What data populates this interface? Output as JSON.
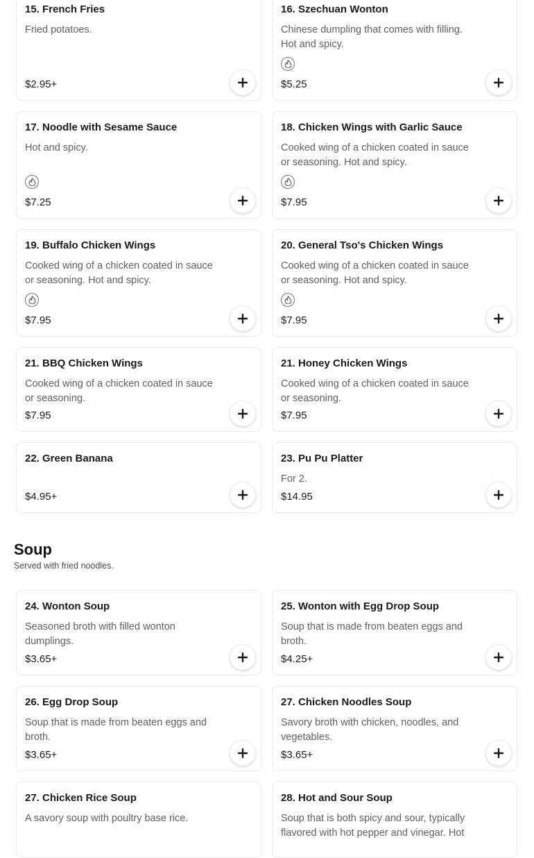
{
  "colors": {
    "accent": "#191919",
    "border": "#ebebeb",
    "muted_text": "#606060",
    "spicy_icon": "#767676"
  },
  "icons": {
    "spicy": "flame-icon",
    "add": "plus-icon"
  },
  "menu_top": {
    "items": [
      {
        "title": "15. French Fries",
        "description": "Fried potatoes.",
        "price": "$2.95+",
        "spicy": false
      },
      {
        "title": "16. Szechuan Wonton",
        "description": "Chinese dumpling that comes with filling. Hot and spicy.",
        "price": "$5.25",
        "spicy": true
      },
      {
        "title": "17. Noodle with Sesame Sauce",
        "description": "Hot and spicy.",
        "price": "$7.25",
        "spicy": true
      },
      {
        "title": "18. Chicken Wings with Garlic Sauce",
        "description": "Cooked wing of a chicken coated in sauce or seasoning. Hot and spicy.",
        "price": "$7.95",
        "spicy": true
      },
      {
        "title": "19. Buffalo Chicken Wings",
        "description": "Cooked wing of a chicken coated in sauce or seasoning. Hot and spicy.",
        "price": "$7.95",
        "spicy": true
      },
      {
        "title": "20. General Tso's Chicken Wings",
        "description": "Cooked wing of a chicken coated in sauce or seasoning. Hot and spicy.",
        "price": "$7.95",
        "spicy": true
      },
      {
        "title": "21. BBQ Chicken Wings",
        "description": "Cooked wing of a chicken coated in sauce or seasoning.",
        "price": "$7.95",
        "spicy": false
      },
      {
        "title": "21. Honey Chicken Wings",
        "description": "Cooked wing of a chicken coated in sauce or seasoning.",
        "price": "$7.95",
        "spicy": false
      },
      {
        "title": "22. Green Banana",
        "description": "",
        "price": "$4.95+",
        "spicy": false
      },
      {
        "title": "23. Pu Pu Platter",
        "description": "For 2.",
        "price": "$14.95",
        "spicy": false
      }
    ]
  },
  "soup_section": {
    "title": "Soup",
    "subtitle": "Served with fried noodles.",
    "items": [
      {
        "title": "24. Wonton Soup",
        "description": "Seasoned broth with filled wonton dumplings.",
        "price": "$3.65+",
        "spicy": false
      },
      {
        "title": "25. Wonton with Egg Drop Soup",
        "description": "Soup that is made from beaten eggs and broth.",
        "price": "$4.25+",
        "spicy": false
      },
      {
        "title": "26. Egg Drop Soup",
        "description": "Soup that is made from beaten eggs and broth.",
        "price": "$3.65+",
        "spicy": false
      },
      {
        "title": "27. Chicken Noodles Soup",
        "description": "Savory broth with chicken, noodles, and vegetables.",
        "price": "$3.65+",
        "spicy": false
      },
      {
        "title": "27. Chicken Rice Soup",
        "description": "A savory soup with poultry base rice.",
        "price": "",
        "spicy": false
      },
      {
        "title": "28. Hot and Sour Soup",
        "description": "Soup that is both spicy and sour, typically flavored with hot pepper and vinegar. Hot",
        "price": "",
        "spicy": false
      }
    ]
  }
}
